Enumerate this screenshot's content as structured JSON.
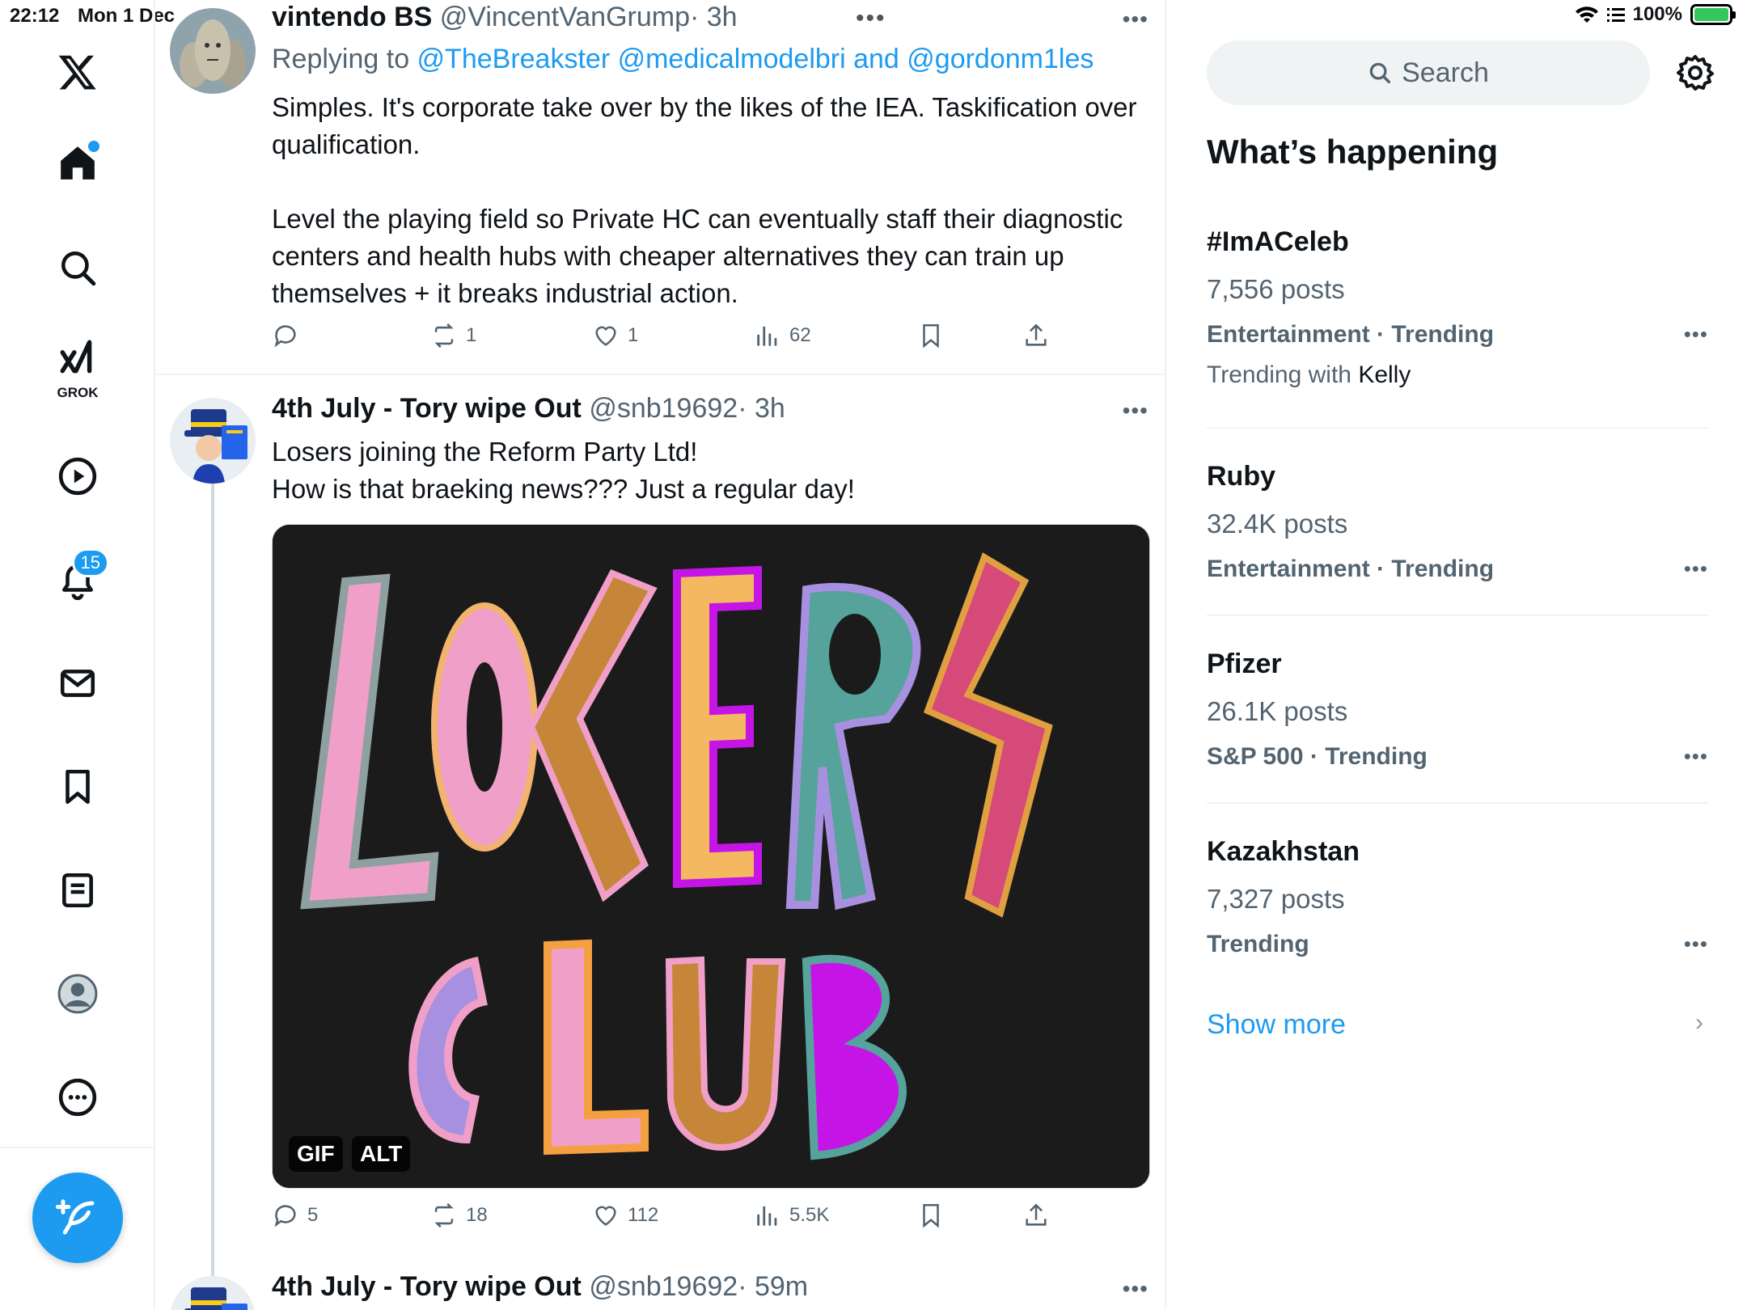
{
  "status_bar": {
    "time": "22:12",
    "date": "Mon 1 Dec",
    "battery": "100%"
  },
  "nav": {
    "notifications_badge": "15",
    "grok_label": "GROK"
  },
  "tweets": [
    {
      "name": "vintendo BS",
      "handle": "@VincentVanGrump",
      "time": "· 3h",
      "replying_prefix": "Replying to ",
      "replying_mentions": "@TheBreakster @medicalmodelbri and @gordonm1les",
      "text_p1": "Simples. It's corporate take over by the likes of the IEA. Taskification over qualification.",
      "text_p2": "Level the playing field so Private HC can eventually staff their diagnostic centers and health hubs with cheaper alternatives they can train up themselves + it breaks industrial action.",
      "replies": "",
      "reposts": "1",
      "likes": "1",
      "views": "62"
    },
    {
      "name": "4th July - Tory wipe Out",
      "handle": "@snb19692",
      "time": "· 3h",
      "text_line1": "Losers joining the Reform Party Ltd!",
      "text_line2": "How is that braeking news??? Just a regular day!",
      "media_tag_gif": "GIF",
      "media_tag_alt": "ALT",
      "replies": "5",
      "reposts": "18",
      "likes": "112",
      "views": "5.5K"
    },
    {
      "name": "4th July - Tory wipe Out",
      "handle": "@snb19692",
      "time": "· 59m"
    }
  ],
  "sidebar": {
    "search_placeholder": "Search",
    "title": "What’s happening",
    "trends": [
      {
        "name": "#ImACeleb",
        "count": "7,556 posts",
        "category": "Entertainment · Trending",
        "with_prefix": "Trending with ",
        "with_name": "Kelly"
      },
      {
        "name": "Ruby",
        "count": "32.4K posts",
        "category": "Entertainment · Trending"
      },
      {
        "name": "Pfizer",
        "count": "26.1K posts",
        "category": "S&P 500 · Trending"
      },
      {
        "name": "Kazakhstan",
        "count": "7,327 posts",
        "category": "Trending"
      }
    ],
    "show_more": "Show more"
  },
  "colors": {
    "accent": "#1d9bf0",
    "text": "#0f1419",
    "muted": "#536471",
    "border": "#eff3f4"
  }
}
